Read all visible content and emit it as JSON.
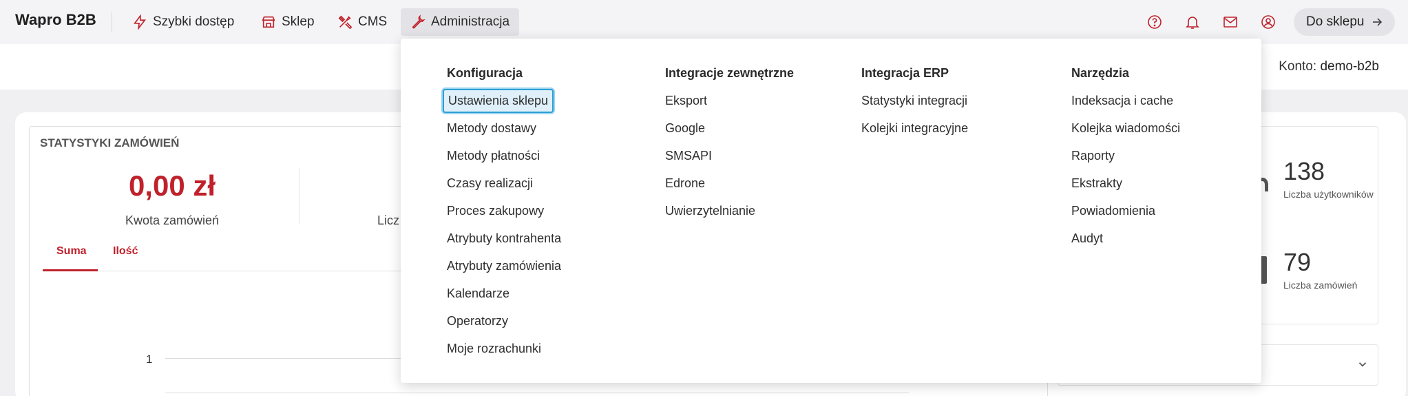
{
  "navbar": {
    "brand": "Wapro B2B",
    "items": [
      {
        "label": "Szybki dostęp",
        "icon": "lightning-icon"
      },
      {
        "label": "Sklep",
        "icon": "store-icon"
      },
      {
        "label": "CMS",
        "icon": "tools-icon"
      },
      {
        "label": "Administracja",
        "icon": "wrench-icon",
        "active": true
      }
    ],
    "right_icons": [
      "help-icon",
      "bell-icon",
      "mail-icon",
      "user-icon"
    ],
    "to_shop_label": "Do sklepu"
  },
  "account": {
    "label": "Konto:",
    "value": "demo-b2b"
  },
  "stats": {
    "title": "STATYSTYKI ZAMÓWIEŃ",
    "amount": "0,00 zł",
    "amount_label": "Kwota zamówień",
    "count_label_partial": "Licz",
    "tabs": [
      "Suma",
      "Ilość"
    ],
    "axis_value": "1"
  },
  "side_stats": [
    {
      "value": "138",
      "label": "Liczba użytkowników"
    },
    {
      "value": "79",
      "label": "Liczba zamówień"
    }
  ],
  "mega_menu": {
    "columns": [
      {
        "header": "Konfiguracja",
        "items": [
          "Ustawienia sklepu",
          "Metody dostawy",
          "Metody płatności",
          "Czasy realizacji",
          "Proces zakupowy",
          "Atrybuty kontrahenta",
          "Atrybuty zamówienia",
          "Kalendarze",
          "Operatorzy",
          "Moje rozrachunki"
        ]
      },
      {
        "header": "Integracje zewnętrzne",
        "items": [
          "Eksport",
          "Google",
          "SMSAPI",
          "Edrone",
          "Uwierzytelnianie"
        ]
      },
      {
        "header": "Integracja ERP",
        "items": [
          "Statystyki integracji",
          "Kolejki integracyjne"
        ]
      },
      {
        "header": "Narzędzia",
        "items": [
          "Indeksacja i cache",
          "Kolejka wiadomości",
          "Raporty",
          "Ekstrakty",
          "Powiadomienia",
          "Audyt"
        ]
      }
    ],
    "focused_item": "Ustawienia sklepu"
  },
  "colors": {
    "accent": "#c0212b",
    "focus": "#2b9fd6"
  }
}
